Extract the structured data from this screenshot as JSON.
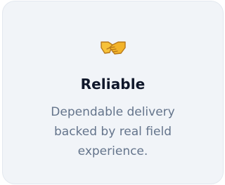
{
  "card": {
    "icon": "handshake-icon",
    "title": "Reliable",
    "description": "Dependable delivery backed by real field experience."
  }
}
